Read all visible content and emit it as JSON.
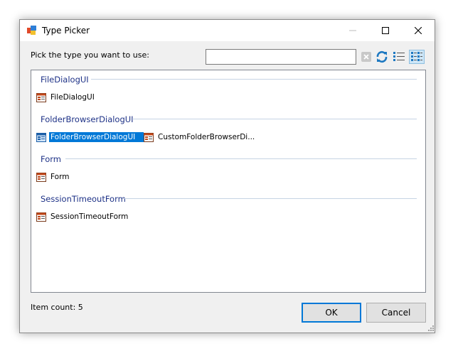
{
  "window": {
    "title": "Type Picker"
  },
  "prompt": {
    "label": "Pick the type you want to use:"
  },
  "search": {
    "value": "",
    "placeholder": ""
  },
  "toolbar": {
    "icons": [
      "clear-icon",
      "refresh-icon",
      "list-view-icon",
      "details-view-icon"
    ]
  },
  "groups": [
    {
      "header": "FileDialogUI",
      "items": [
        {
          "label": "FileDialogUI",
          "selected": false
        }
      ]
    },
    {
      "header": "FolderBrowserDialogUI",
      "items": [
        {
          "label": "FolderBrowserDialogUI",
          "selected": true
        },
        {
          "label": "CustomFolderBrowserDi...",
          "selected": false
        }
      ]
    },
    {
      "header": "Form",
      "items": [
        {
          "label": "Form",
          "selected": false
        }
      ]
    },
    {
      "header": "SessionTimeoutForm",
      "items": [
        {
          "label": "SessionTimeoutForm",
          "selected": false
        }
      ]
    }
  ],
  "status": {
    "item_count": "Item count: 5"
  },
  "buttons": {
    "ok": "OK",
    "cancel": "Cancel"
  },
  "colors": {
    "accent": "#0078d7",
    "group_header": "#1e3287",
    "selection": "#0078d7"
  }
}
